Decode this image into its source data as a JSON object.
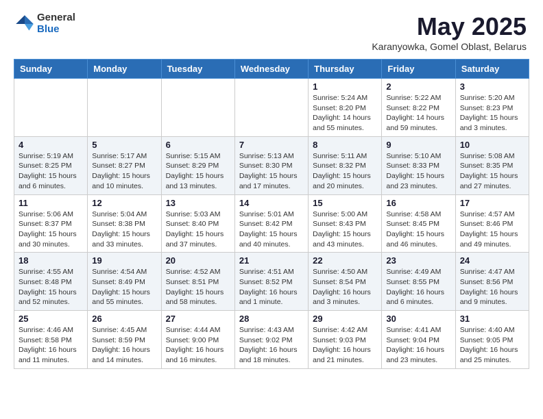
{
  "header": {
    "logo_general": "General",
    "logo_blue": "Blue",
    "month_title": "May 2025",
    "subtitle": "Karanyowka, Gomel Oblast, Belarus"
  },
  "weekdays": [
    "Sunday",
    "Monday",
    "Tuesday",
    "Wednesday",
    "Thursday",
    "Friday",
    "Saturday"
  ],
  "weeks": [
    [
      {
        "day": "",
        "info": ""
      },
      {
        "day": "",
        "info": ""
      },
      {
        "day": "",
        "info": ""
      },
      {
        "day": "",
        "info": ""
      },
      {
        "day": "1",
        "info": "Sunrise: 5:24 AM\nSunset: 8:20 PM\nDaylight: 14 hours\nand 55 minutes."
      },
      {
        "day": "2",
        "info": "Sunrise: 5:22 AM\nSunset: 8:22 PM\nDaylight: 14 hours\nand 59 minutes."
      },
      {
        "day": "3",
        "info": "Sunrise: 5:20 AM\nSunset: 8:23 PM\nDaylight: 15 hours\nand 3 minutes."
      }
    ],
    [
      {
        "day": "4",
        "info": "Sunrise: 5:19 AM\nSunset: 8:25 PM\nDaylight: 15 hours\nand 6 minutes."
      },
      {
        "day": "5",
        "info": "Sunrise: 5:17 AM\nSunset: 8:27 PM\nDaylight: 15 hours\nand 10 minutes."
      },
      {
        "day": "6",
        "info": "Sunrise: 5:15 AM\nSunset: 8:29 PM\nDaylight: 15 hours\nand 13 minutes."
      },
      {
        "day": "7",
        "info": "Sunrise: 5:13 AM\nSunset: 8:30 PM\nDaylight: 15 hours\nand 17 minutes."
      },
      {
        "day": "8",
        "info": "Sunrise: 5:11 AM\nSunset: 8:32 PM\nDaylight: 15 hours\nand 20 minutes."
      },
      {
        "day": "9",
        "info": "Sunrise: 5:10 AM\nSunset: 8:33 PM\nDaylight: 15 hours\nand 23 minutes."
      },
      {
        "day": "10",
        "info": "Sunrise: 5:08 AM\nSunset: 8:35 PM\nDaylight: 15 hours\nand 27 minutes."
      }
    ],
    [
      {
        "day": "11",
        "info": "Sunrise: 5:06 AM\nSunset: 8:37 PM\nDaylight: 15 hours\nand 30 minutes."
      },
      {
        "day": "12",
        "info": "Sunrise: 5:04 AM\nSunset: 8:38 PM\nDaylight: 15 hours\nand 33 minutes."
      },
      {
        "day": "13",
        "info": "Sunrise: 5:03 AM\nSunset: 8:40 PM\nDaylight: 15 hours\nand 37 minutes."
      },
      {
        "day": "14",
        "info": "Sunrise: 5:01 AM\nSunset: 8:42 PM\nDaylight: 15 hours\nand 40 minutes."
      },
      {
        "day": "15",
        "info": "Sunrise: 5:00 AM\nSunset: 8:43 PM\nDaylight: 15 hours\nand 43 minutes."
      },
      {
        "day": "16",
        "info": "Sunrise: 4:58 AM\nSunset: 8:45 PM\nDaylight: 15 hours\nand 46 minutes."
      },
      {
        "day": "17",
        "info": "Sunrise: 4:57 AM\nSunset: 8:46 PM\nDaylight: 15 hours\nand 49 minutes."
      }
    ],
    [
      {
        "day": "18",
        "info": "Sunrise: 4:55 AM\nSunset: 8:48 PM\nDaylight: 15 hours\nand 52 minutes."
      },
      {
        "day": "19",
        "info": "Sunrise: 4:54 AM\nSunset: 8:49 PM\nDaylight: 15 hours\nand 55 minutes."
      },
      {
        "day": "20",
        "info": "Sunrise: 4:52 AM\nSunset: 8:51 PM\nDaylight: 15 hours\nand 58 minutes."
      },
      {
        "day": "21",
        "info": "Sunrise: 4:51 AM\nSunset: 8:52 PM\nDaylight: 16 hours\nand 1 minute."
      },
      {
        "day": "22",
        "info": "Sunrise: 4:50 AM\nSunset: 8:54 PM\nDaylight: 16 hours\nand 3 minutes."
      },
      {
        "day": "23",
        "info": "Sunrise: 4:49 AM\nSunset: 8:55 PM\nDaylight: 16 hours\nand 6 minutes."
      },
      {
        "day": "24",
        "info": "Sunrise: 4:47 AM\nSunset: 8:56 PM\nDaylight: 16 hours\nand 9 minutes."
      }
    ],
    [
      {
        "day": "25",
        "info": "Sunrise: 4:46 AM\nSunset: 8:58 PM\nDaylight: 16 hours\nand 11 minutes."
      },
      {
        "day": "26",
        "info": "Sunrise: 4:45 AM\nSunset: 8:59 PM\nDaylight: 16 hours\nand 14 minutes."
      },
      {
        "day": "27",
        "info": "Sunrise: 4:44 AM\nSunset: 9:00 PM\nDaylight: 16 hours\nand 16 minutes."
      },
      {
        "day": "28",
        "info": "Sunrise: 4:43 AM\nSunset: 9:02 PM\nDaylight: 16 hours\nand 18 minutes."
      },
      {
        "day": "29",
        "info": "Sunrise: 4:42 AM\nSunset: 9:03 PM\nDaylight: 16 hours\nand 21 minutes."
      },
      {
        "day": "30",
        "info": "Sunrise: 4:41 AM\nSunset: 9:04 PM\nDaylight: 16 hours\nand 23 minutes."
      },
      {
        "day": "31",
        "info": "Sunrise: 4:40 AM\nSunset: 9:05 PM\nDaylight: 16 hours\nand 25 minutes."
      }
    ]
  ]
}
